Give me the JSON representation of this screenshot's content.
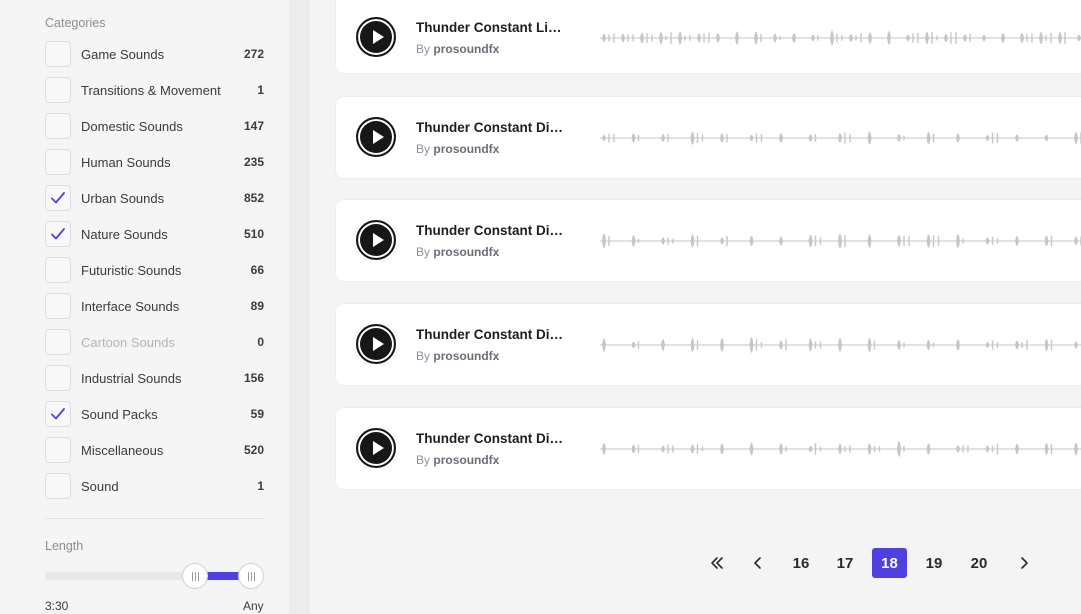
{
  "filters": {
    "categories_title": "Categories",
    "categories": [
      {
        "label": "Game Sounds",
        "count": "272",
        "checked": false,
        "disabled": false
      },
      {
        "label": "Transitions & Movement",
        "count": "1",
        "checked": false,
        "disabled": false
      },
      {
        "label": "Domestic Sounds",
        "count": "147",
        "checked": false,
        "disabled": false
      },
      {
        "label": "Human Sounds",
        "count": "235",
        "checked": false,
        "disabled": false
      },
      {
        "label": "Urban Sounds",
        "count": "852",
        "checked": true,
        "disabled": false
      },
      {
        "label": "Nature Sounds",
        "count": "510",
        "checked": true,
        "disabled": false
      },
      {
        "label": "Futuristic Sounds",
        "count": "66",
        "checked": false,
        "disabled": false
      },
      {
        "label": "Interface Sounds",
        "count": "89",
        "checked": false,
        "disabled": false
      },
      {
        "label": "Cartoon Sounds",
        "count": "0",
        "checked": false,
        "disabled": true
      },
      {
        "label": "Industrial Sounds",
        "count": "156",
        "checked": false,
        "disabled": false
      },
      {
        "label": "Sound Packs",
        "count": "59",
        "checked": true,
        "disabled": false
      },
      {
        "label": "Miscellaneous",
        "count": "520",
        "checked": false,
        "disabled": false
      },
      {
        "label": "Sound",
        "count": "1",
        "checked": false,
        "disabled": false
      }
    ],
    "length_title": "Length",
    "length_min": "3:30",
    "length_max": "Any"
  },
  "tracks": [
    {
      "title": "Thunder Constant Lightning",
      "by_prefix": "By",
      "author": "prosoundfx"
    },
    {
      "title": "Thunder Constant Distant",
      "by_prefix": "By",
      "author": "prosoundfx"
    },
    {
      "title": "Thunder Constant Distant",
      "by_prefix": "By",
      "author": "prosoundfx"
    },
    {
      "title": "Thunder Constant Distant",
      "by_prefix": "By",
      "author": "prosoundfx"
    },
    {
      "title": "Thunder Constant Distant",
      "by_prefix": "By",
      "author": "prosoundfx"
    }
  ],
  "pagination": {
    "first_icon": "double-chevron-left-icon",
    "prev_icon": "chevron-left-icon",
    "pages": [
      "16",
      "17",
      "18",
      "19",
      "20"
    ],
    "current": "18",
    "next_icon": "chevron-right-icon"
  },
  "colors": {
    "accent": "#5140e0",
    "waveform": "#c6c6ca",
    "play_button": "#17171a"
  }
}
